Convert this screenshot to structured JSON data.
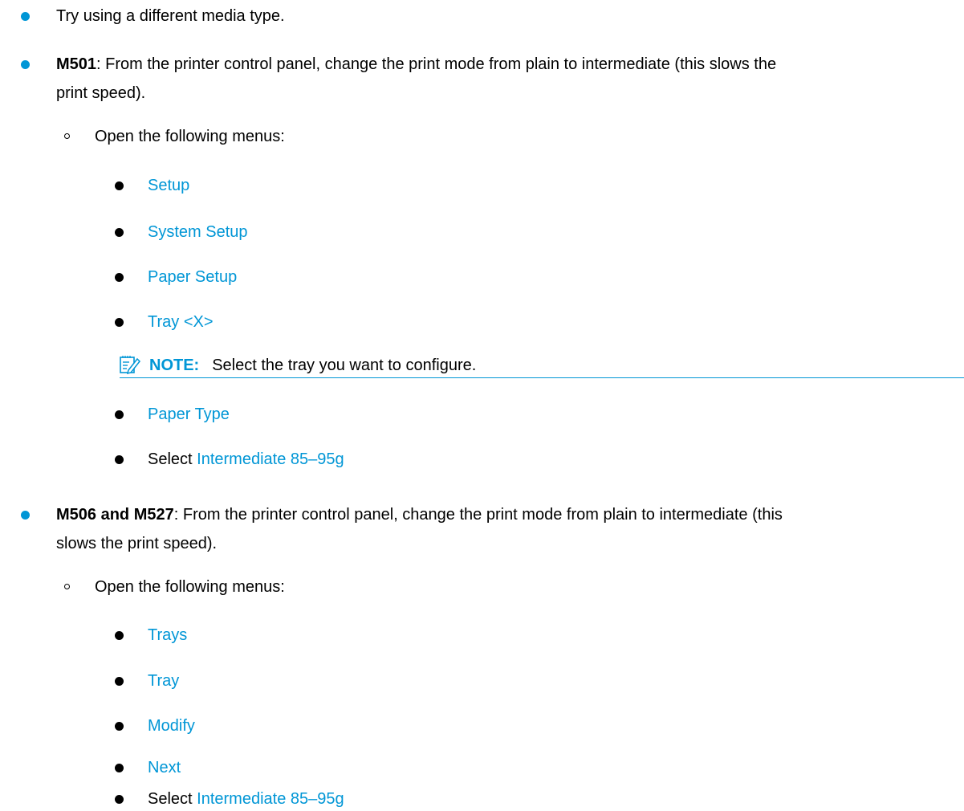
{
  "items": {
    "media_type": "Try using a different media type.",
    "m501": {
      "model": "M501",
      "text_line1": ": From the printer control panel, change the print mode from plain to intermediate (this slows the",
      "text_line2": "print speed).",
      "sub": "Open the following menus:",
      "menus": [
        "Setup",
        "System Setup",
        "Paper Setup",
        "Tray <X>"
      ],
      "note_label": "NOTE:",
      "note_text": "Select the tray you want to configure.",
      "menus2": [
        "Paper Type"
      ],
      "select_prefix": "Select",
      "select_value": "Intermediate 85–95g"
    },
    "m506": {
      "model": "M506 and M527",
      "text_line1": ": From the printer control panel, change the print mode from plain to intermediate (this",
      "text_line2": "slows the print speed).",
      "sub": "Open the following menus:",
      "menus": [
        "Trays",
        "Tray",
        "Modify",
        "Next"
      ],
      "select_prefix": "Select",
      "select_value": "Intermediate 85–95g"
    }
  },
  "colors": {
    "link": "#0096d6",
    "text": "#000000"
  },
  "icons": {
    "note": "note-pencil-icon"
  }
}
